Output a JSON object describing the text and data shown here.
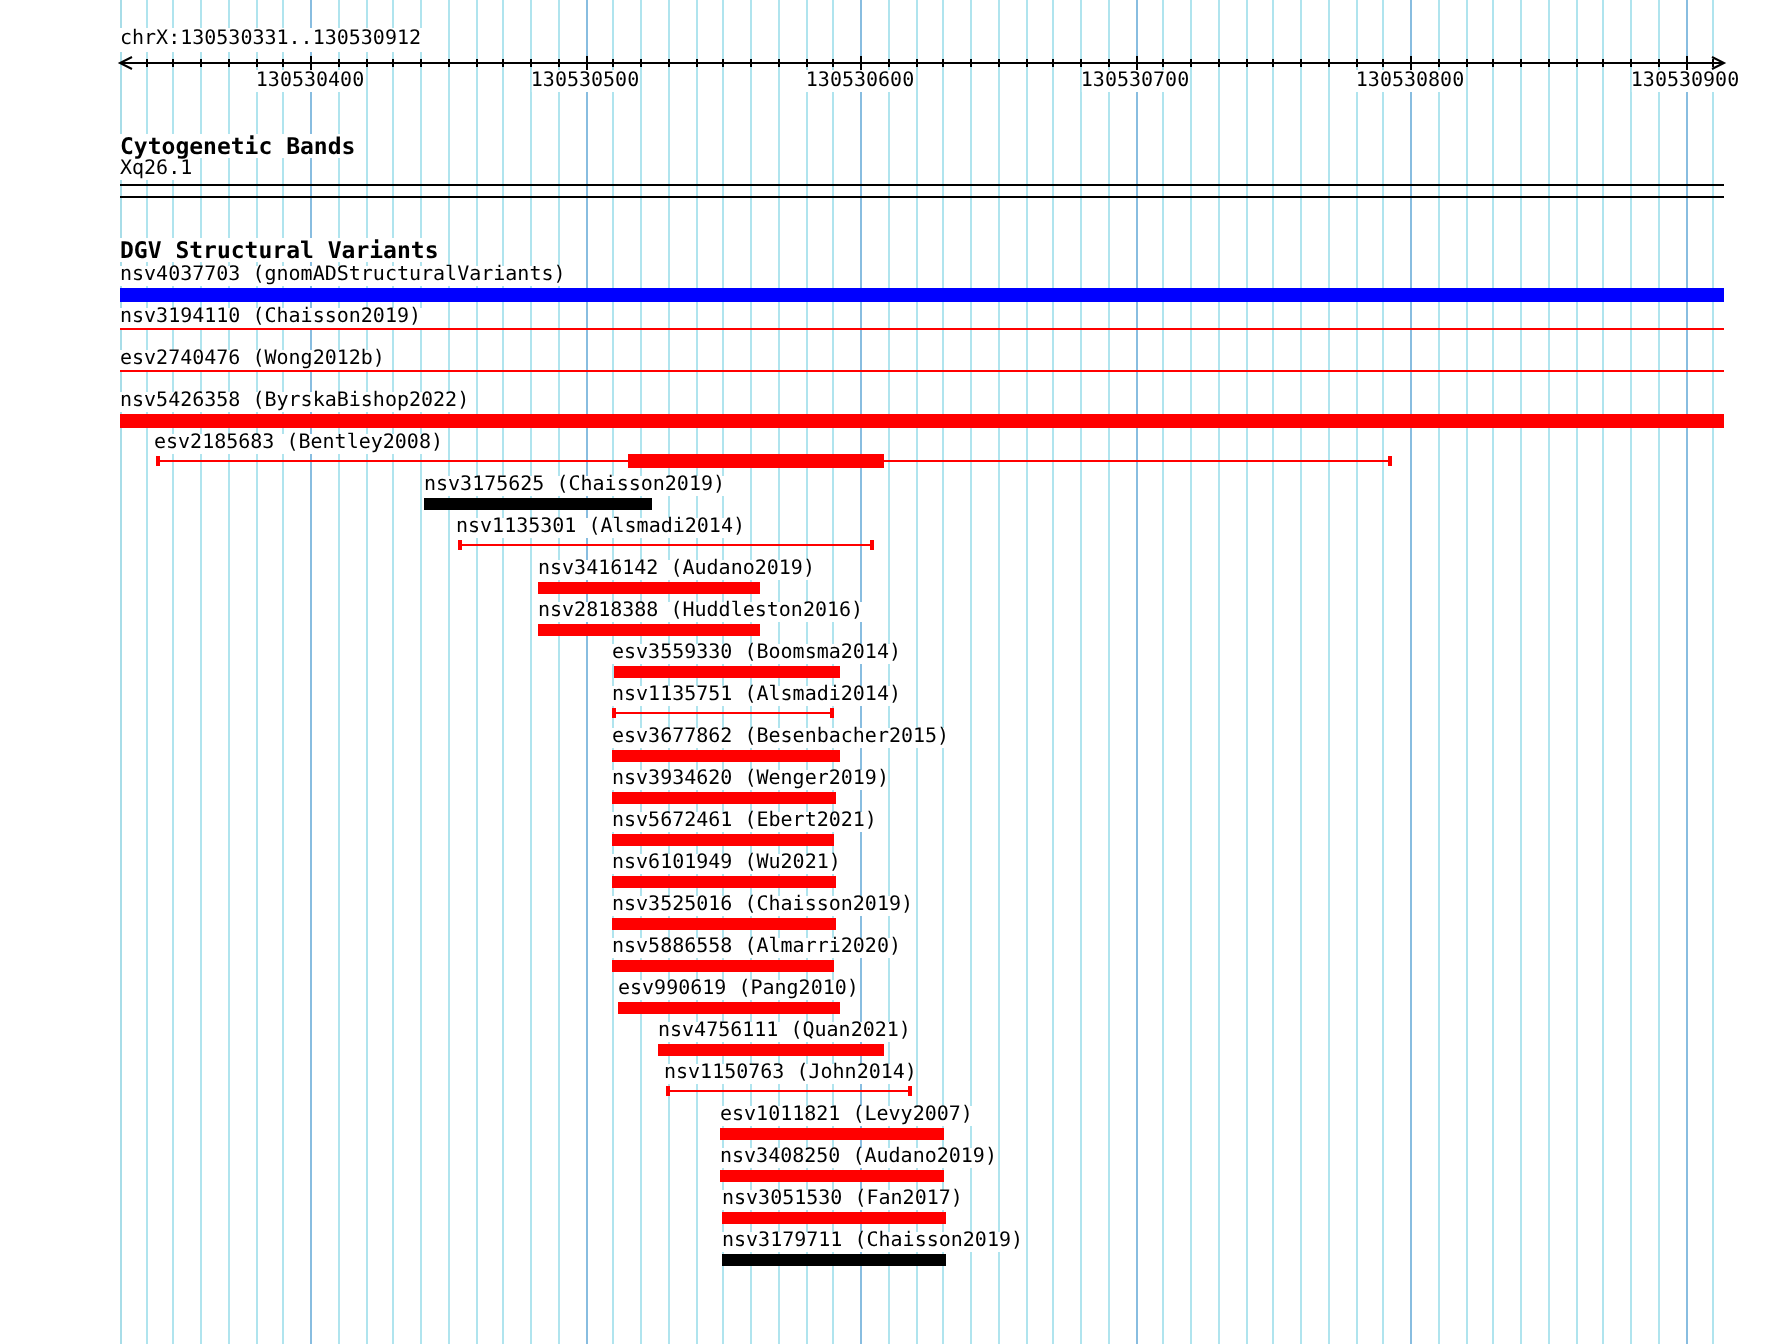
{
  "location": "chrX:130530331..130530912",
  "ruler": {
    "ticks": [
      "130530400",
      "130530500",
      "130530600",
      "130530700",
      "130530800",
      "130530900"
    ]
  },
  "cytogenetic_bands": {
    "title": "Cytogenetic Bands",
    "band": "Xq26.1"
  },
  "structural_variants": {
    "title": "DGV Structural Variants",
    "items": [
      {
        "label": "nsv4037703 (gnomADStructuralVariants)",
        "kind": "bar",
        "color": "#0000ff"
      },
      {
        "label": "nsv3194110 (Chaisson2019)",
        "kind": "line",
        "color": "#ff0000"
      },
      {
        "label": "esv2740476 (Wong2012b)",
        "kind": "line",
        "color": "#ff0000"
      },
      {
        "label": "nsv5426358 (ByrskaBishop2022)",
        "kind": "bar",
        "color": "#ff0000"
      },
      {
        "label": "esv2185683 (Bentley2008)",
        "kind": "core",
        "color": "#ff0000"
      },
      {
        "label": "nsv3175625 (Chaisson2019)",
        "kind": "bar",
        "color": "#000000"
      },
      {
        "label": "nsv1135301 (Alsmadi2014)",
        "kind": "line",
        "color": "#ff0000"
      },
      {
        "label": "nsv3416142 (Audano2019)",
        "kind": "bar",
        "color": "#ff0000"
      },
      {
        "label": "nsv2818388 (Huddleston2016)",
        "kind": "bar",
        "color": "#ff0000"
      },
      {
        "label": "esv3559330 (Boomsma2014)",
        "kind": "bar",
        "color": "#ff0000"
      },
      {
        "label": "nsv1135751 (Alsmadi2014)",
        "kind": "line",
        "color": "#ff0000"
      },
      {
        "label": "esv3677862 (Besenbacher2015)",
        "kind": "bar",
        "color": "#ff0000"
      },
      {
        "label": "nsv3934620 (Wenger2019)",
        "kind": "bar",
        "color": "#ff0000"
      },
      {
        "label": "nsv5672461 (Ebert2021)",
        "kind": "bar",
        "color": "#ff0000"
      },
      {
        "label": "nsv6101949 (Wu2021)",
        "kind": "bar",
        "color": "#ff0000"
      },
      {
        "label": "nsv3525016 (Chaisson2019)",
        "kind": "bar",
        "color": "#ff0000"
      },
      {
        "label": "nsv5886558 (Almarri2020)",
        "kind": "bar",
        "color": "#ff0000"
      },
      {
        "label": "esv990619 (Pang2010)",
        "kind": "bar",
        "color": "#ff0000"
      },
      {
        "label": "nsv4756111 (Quan2021)",
        "kind": "bar",
        "color": "#ff0000"
      },
      {
        "label": "nsv1150763 (John2014)",
        "kind": "line",
        "color": "#ff0000"
      },
      {
        "label": "esv1011821 (Levy2007)",
        "kind": "bar",
        "color": "#ff0000"
      },
      {
        "label": "nsv3408250 (Audano2019)",
        "kind": "bar",
        "color": "#ff0000"
      },
      {
        "label": "nsv3051530 (Fan2017)",
        "kind": "bar",
        "color": "#ff0000"
      },
      {
        "label": "nsv3179711 (Chaisson2019)",
        "kind": "bar",
        "color": "#000000"
      }
    ]
  }
}
